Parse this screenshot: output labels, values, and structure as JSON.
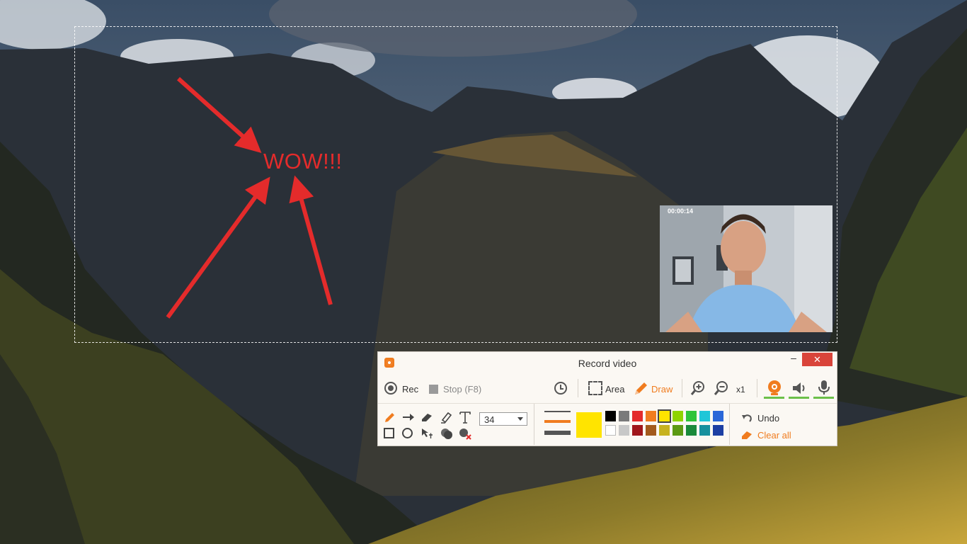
{
  "annotation": {
    "text": "WOW!!!",
    "color": "#e42b2b"
  },
  "webcam": {
    "timestamp": "00:00:14"
  },
  "recorder": {
    "title": "Record video",
    "window_controls": {
      "minimize": "–",
      "close": "✕"
    },
    "toolbar": {
      "rec_label": "Rec",
      "stop_label": "Stop (F8)",
      "area_label": "Area",
      "draw_label": "Draw",
      "zoom_level": "x1"
    },
    "draw_tools": {
      "font_size": "34",
      "undo_label": "Undo",
      "clear_label": "Clear all",
      "selected_color": "#ffe400",
      "palette_top": [
        "#000000",
        "#7a7a7a",
        "#e42b2b",
        "#f07c1f",
        "#ffe400",
        "#8fd400",
        "#2fc43a",
        "#1fc6d8",
        "#2a67d8"
      ],
      "palette_bottom": [
        "#ffffff",
        "#c8c8c8",
        "#a0161c",
        "#a35a1d",
        "#c7b21f",
        "#5c9a14",
        "#1a8a3a",
        "#17909e",
        "#1c3fa3"
      ]
    },
    "accent_color": "#f07c1f"
  }
}
